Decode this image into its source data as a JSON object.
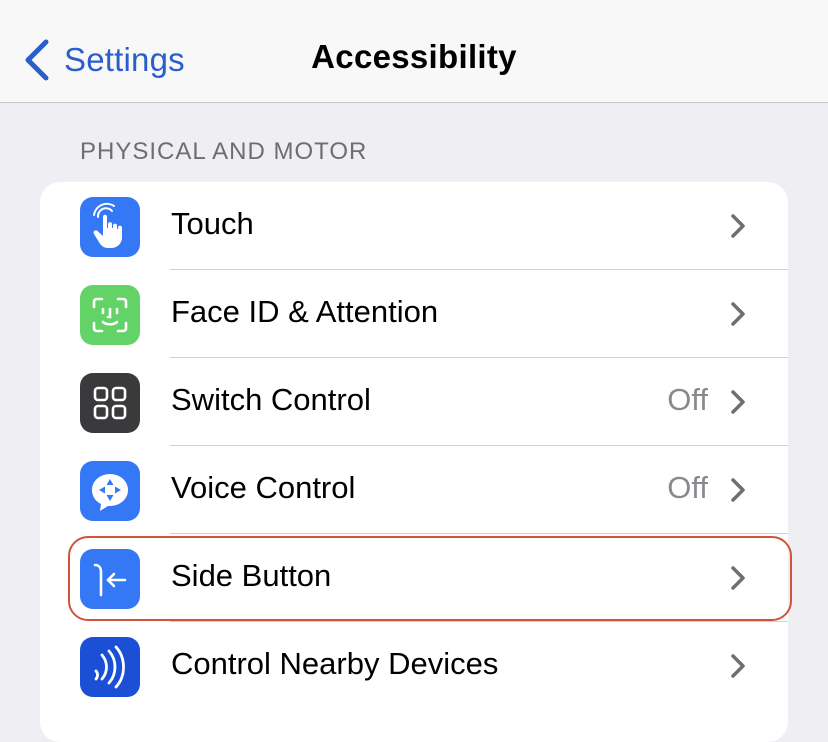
{
  "navbar": {
    "back_label": "Settings",
    "title": "Accessibility"
  },
  "section": {
    "header": "PHYSICAL AND MOTOR"
  },
  "rows": [
    {
      "label": "Touch",
      "value": "",
      "icon": "hand-pointer-icon",
      "icon_bg": "#3478F6"
    },
    {
      "label": "Face ID & Attention",
      "value": "",
      "icon": "face-id-icon",
      "icon_bg": "#64D367"
    },
    {
      "label": "Switch Control",
      "value": "Off",
      "icon": "switch-control-grid-icon",
      "icon_bg": "#3A3A3C"
    },
    {
      "label": "Voice Control",
      "value": "Off",
      "icon": "voice-control-icon",
      "icon_bg": "#3478F6"
    },
    {
      "label": "Side Button",
      "value": "",
      "icon": "side-button-icon",
      "icon_bg": "#3478F6"
    },
    {
      "label": "Control Nearby Devices",
      "value": "",
      "icon": "nearby-devices-icon",
      "icon_bg": "#1A4FD6"
    }
  ],
  "colors": {
    "accent": "#2A5FCB",
    "highlight": "#D0533B"
  }
}
